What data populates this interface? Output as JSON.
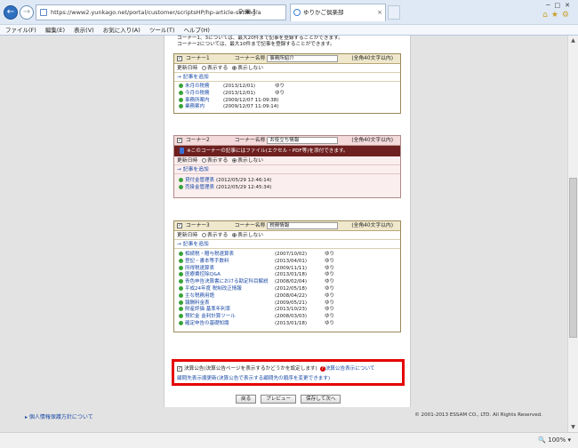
{
  "browser": {
    "url": "https://www2.yunkago.net/portal/customer/scriptsHP/hp-article-setting.a",
    "tab_title": "ゆりかご倶楽部",
    "menu": [
      "ファイル(F)",
      "編集(E)",
      "表示(V)",
      "お気に入り(A)",
      "ツール(T)",
      "ヘルプ(H)"
    ],
    "zoom": "100%"
  },
  "intro": {
    "line1": "コーナー1、3については、最大20件まで記事を登録することができます。",
    "line2": "コーナー2については、最大10件まで記事を登録することができます。"
  },
  "labels": {
    "corner_name": "コーナー名称",
    "hint": "(全角40文字以内)",
    "update_date": "更新日時",
    "show": "表示する",
    "hide": "表示しない",
    "add_article": "→ 記事を追加"
  },
  "corners": [
    {
      "label": "コーナー1",
      "name": "事務所紹介",
      "articles": [
        {
          "title": "未月の税務",
          "date": "(2013/12/01)",
          "user": "ゆり"
        },
        {
          "title": "今月の税務",
          "date": "(2013/12/01)",
          "user": "ゆり"
        },
        {
          "title": "事務所案内",
          "date": "(2009/12/07 11:09:38)",
          "user": ""
        },
        {
          "title": "業務案内",
          "date": "(2009/12/07 11:09:14)",
          "user": ""
        }
      ]
    },
    {
      "label": "コーナー2",
      "name": "お役立ち情報",
      "notice": "※このコーナーの記事にはファイル(エクセル・PDF等)を添付できます。",
      "articles": [
        {
          "title": "貸付金管理表",
          "date": "(2012/05/29 12:46:14)",
          "user": ""
        },
        {
          "title": "売掛金管理表",
          "date": "(2012/05/29 12:45:34)",
          "user": ""
        }
      ]
    },
    {
      "label": "コーナー3",
      "name": "税務情報",
      "articles": [
        {
          "title": "相続税・贈与税速算表",
          "date": "(2007/10/02)",
          "user": "ゆり"
        },
        {
          "title": "登記・書本等手数料",
          "date": "(2013/04/01)",
          "user": "ゆり"
        },
        {
          "title": "所得税速算表",
          "date": "(2009/11/11)",
          "user": "ゆり"
        },
        {
          "title": "医療費控除Q&A",
          "date": "(2013/01/18)",
          "user": "ゆり"
        },
        {
          "title": "青色申告決算書における勘定科目解説",
          "date": "(2008/02/04)",
          "user": "ゆり"
        },
        {
          "title": "平成24年度 税制改正情報",
          "date": "(2012/05/18)",
          "user": "ゆり"
        },
        {
          "title": "主な税務用語",
          "date": "(2008/04/22)",
          "user": "ゆり"
        },
        {
          "title": "報酬料金表",
          "date": "(2009/05/21)",
          "user": "ゆり"
        },
        {
          "title": "財産評価 基準年利率",
          "date": "(2013/10/23)",
          "user": "ゆり"
        },
        {
          "title": "预贮金 金利計算ツール",
          "date": "(2008/03/03)",
          "user": "ゆり"
        },
        {
          "title": "確定申告の基礎知識",
          "date": "(2013/01/18)",
          "user": "ゆり"
        }
      ]
    }
  ],
  "settlement": {
    "line1": "決算公告(決算公告ページを表示するかどうかを設定します)",
    "help": "決算公告表示について",
    "line2": "顧問先表示順更新(決算公告で表示する顧問先の順序を変更できます)"
  },
  "buttons": {
    "back": "戻る",
    "preview": "プレビュー",
    "save": "保存して次へ"
  },
  "footer": {
    "privacy": "個人情報保護方針について",
    "copyright": "© 2001-2013 ESSAM CO., LTD. All Rights Reserved."
  }
}
